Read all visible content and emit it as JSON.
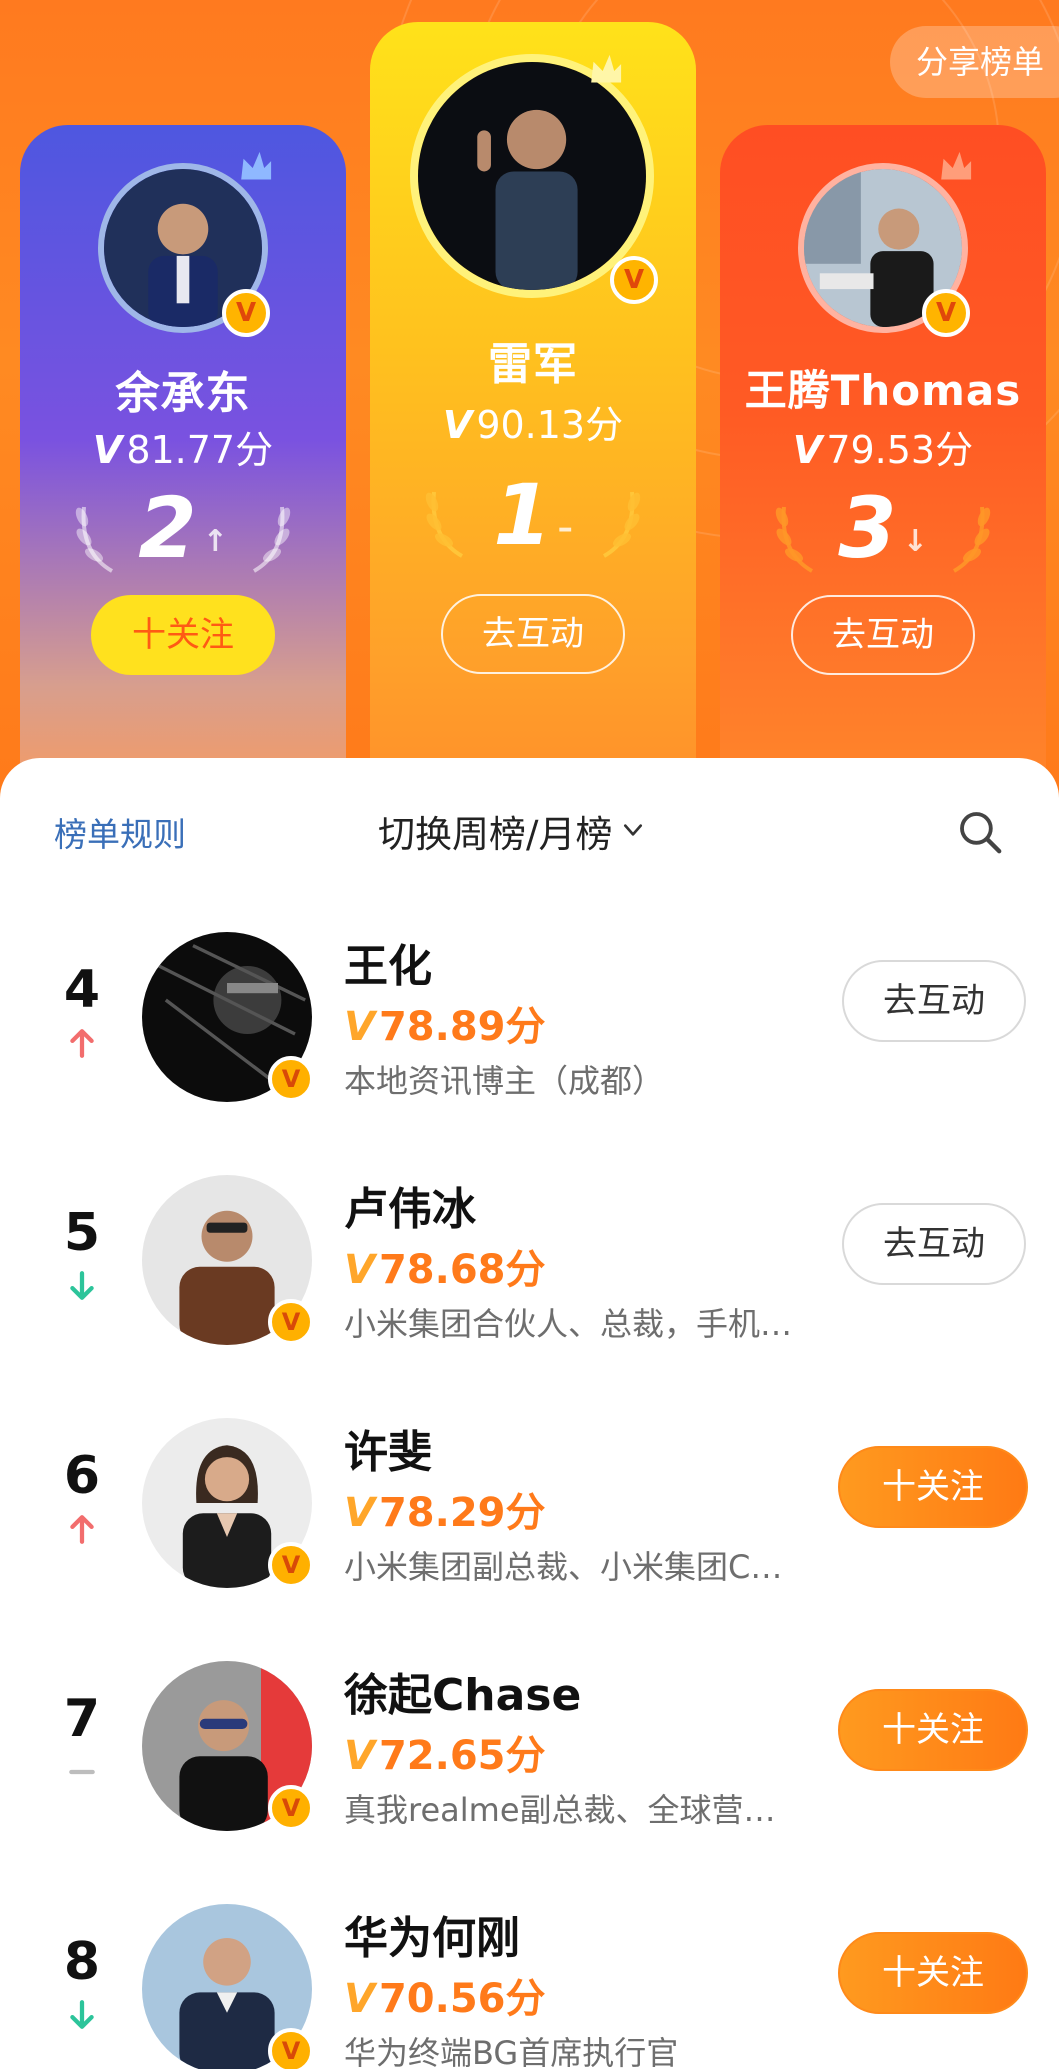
{
  "header": {
    "share_label": "分享榜单",
    "podium": [
      {
        "rank": "2",
        "name": "余承东",
        "score": "81.77分",
        "trend": "up",
        "button": "十关注",
        "button_type": "follow",
        "card_color": "#5a55e2"
      },
      {
        "rank": "1",
        "name": "雷军",
        "score": "90.13分",
        "trend": "flat",
        "button": "去互动",
        "button_type": "interact",
        "card_color": "#ffd21e"
      },
      {
        "rank": "3",
        "name": "王腾Thomas",
        "score": "79.53分",
        "trend": "down",
        "button": "去互动",
        "button_type": "interact",
        "card_color": "#ff5023"
      }
    ]
  },
  "toolbar": {
    "rules_label": "榜单规则",
    "switch_label": "切换周榜/月榜"
  },
  "list": [
    {
      "rank": "4",
      "trend": "up",
      "name": "王化",
      "score": "78.89分",
      "desc": "本地资讯博主（成都）",
      "button": "去互动",
      "button_type": "interact"
    },
    {
      "rank": "5",
      "trend": "down",
      "name": "卢伟冰",
      "score": "78.68分",
      "desc": "小米集团合伙人、总裁，手机…",
      "button": "去互动",
      "button_type": "interact"
    },
    {
      "rank": "6",
      "trend": "up",
      "name": "许斐",
      "score": "78.29分",
      "desc": "小米集团副总裁、小米集团C…",
      "button": "十关注",
      "button_type": "follow"
    },
    {
      "rank": "7",
      "trend": "flat",
      "name": "徐起Chase",
      "score": "72.65分",
      "desc": "真我realme副总裁、全球营…",
      "button": "十关注",
      "button_type": "follow"
    },
    {
      "rank": "8",
      "trend": "down",
      "name": "华为何刚",
      "score": "70.56分",
      "desc": "华为终端BG首席执行官",
      "button": "十关注",
      "button_type": "follow"
    }
  ],
  "colors": {
    "accent_orange": "#ff7a1a",
    "trend_up": "#f26d6d",
    "trend_down": "#2cc49a",
    "rules_link": "#3a6fb8"
  },
  "icons": {
    "verified": "verified-v-icon",
    "search": "search-icon",
    "chevron": "chevron-down-icon",
    "laurel": "laurel-icon",
    "crown": "crown-icon"
  },
  "v_mark": "V"
}
